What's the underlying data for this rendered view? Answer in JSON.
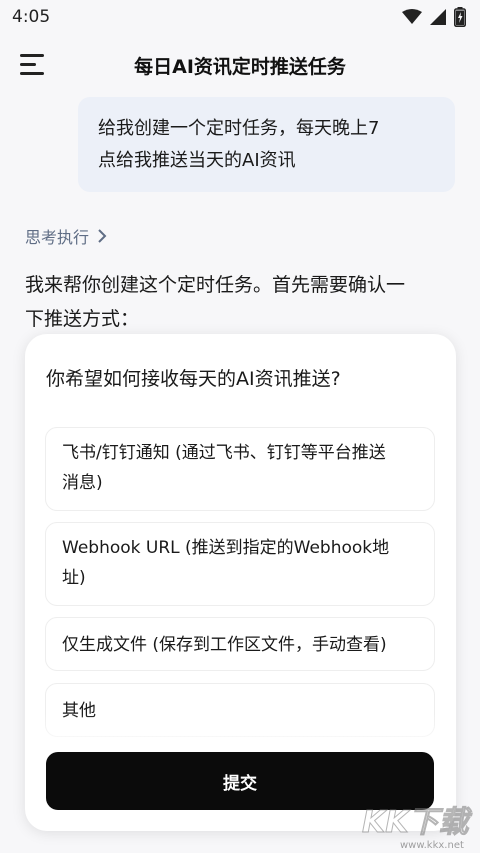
{
  "status_bar": {
    "time": "4:05"
  },
  "header": {
    "title": "每日AI资讯定时推送任务"
  },
  "user_message": {
    "line1": "给我创建一个定时任务，每天晚上7",
    "line2": "点给我推送当天的AI资讯"
  },
  "thinking": {
    "label": "思考执行"
  },
  "assistant": {
    "line1": "我来帮你创建这个定时任务。首先需要确认一",
    "line2": "下推送方式："
  },
  "question_sheet": {
    "question": "你希望如何接收每天的AI资讯推送?",
    "options": [
      {
        "line1": "飞书/钉钉通知 (通过飞书、钉钉等平台推送",
        "line2": "消息)"
      },
      {
        "line1": "Webhook URL (推送到指定的Webhook地",
        "line2": "址)"
      },
      {
        "line1": "仅生成文件 (保存到工作区文件，手动查看)"
      },
      {
        "line1": "其他"
      }
    ],
    "submit_label": "提交"
  },
  "watermark": {
    "text": "KK下载",
    "url": "www.kkx.net"
  }
}
